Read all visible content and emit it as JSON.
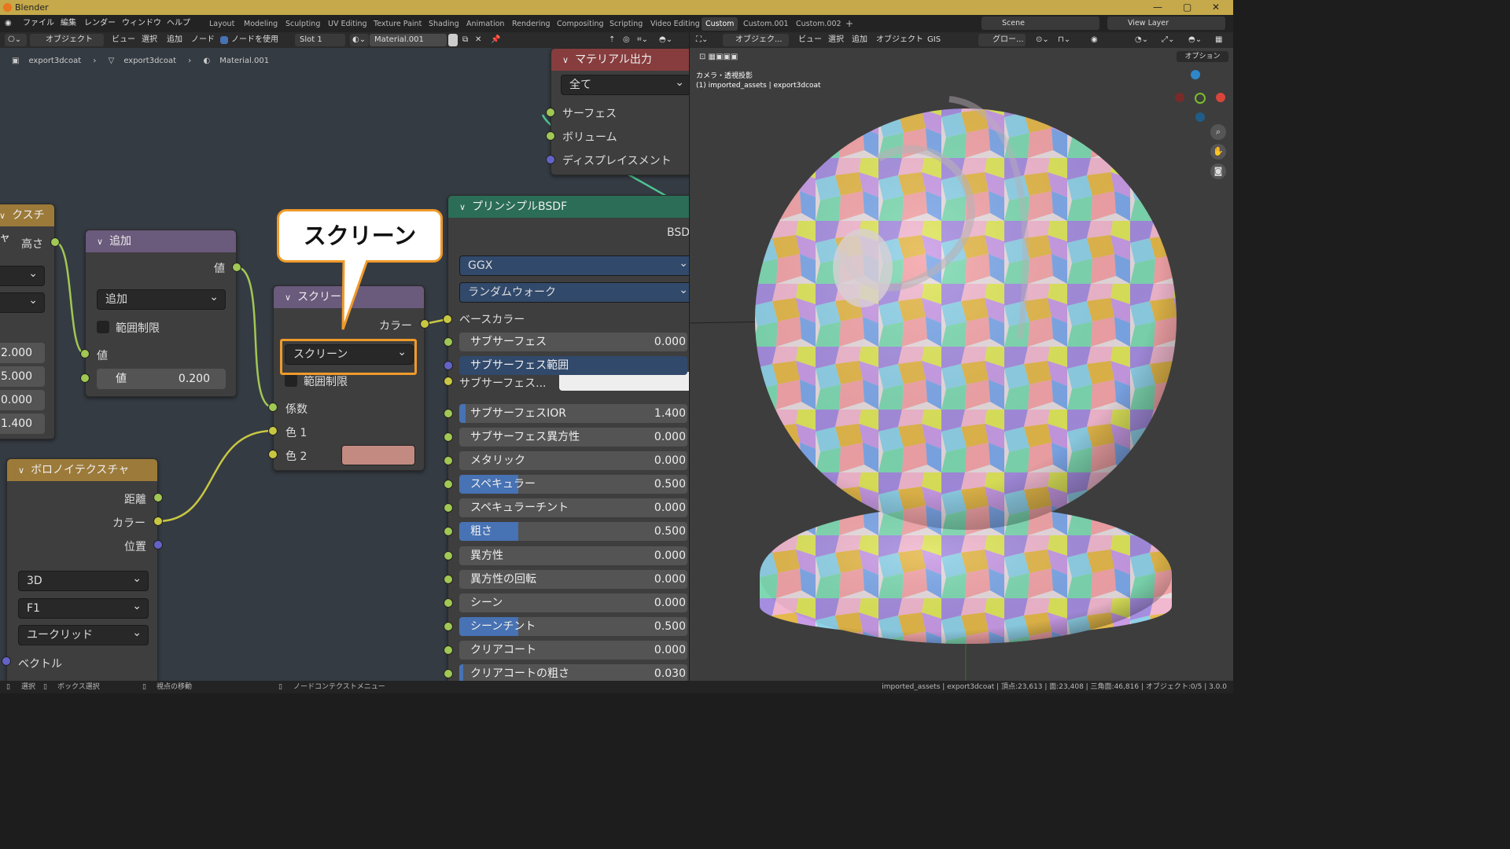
{
  "app": {
    "title": "Blender",
    "menu": [
      "ファイル",
      "編集",
      "レンダー",
      "ウィンドウ",
      "ヘルプ"
    ],
    "workspaces": [
      "Layout",
      "Modeling",
      "Sculpting",
      "UV Editing",
      "Texture Paint",
      "Shading",
      "Animation",
      "Rendering",
      "Compositing",
      "Scripting",
      "Video Editing",
      "Custom",
      "Custom.001",
      "Custom.002"
    ],
    "active_workspace": "Custom",
    "add_workspace": "+",
    "scene": "Scene",
    "view_layer": "View Layer"
  },
  "node_header": {
    "mode": "オブジェクト",
    "view": "ビュー",
    "select": "選択",
    "add": "追加",
    "node": "ノード",
    "use_nodes": "ノードを使用",
    "slot": "Slot 1",
    "material": "Material.001"
  },
  "breadcrumb": [
    "export3dcoat",
    "export3dcoat",
    "Material.001"
  ],
  "callout": {
    "text": "スクリーン"
  },
  "nodes": {
    "tex_left": {
      "title": "クスチャ",
      "out_height": "高さ",
      "values": [
        "2.000",
        "5.000",
        "0.000",
        "1.400"
      ]
    },
    "add": {
      "title": "追加",
      "out_value": "値",
      "operation": "追加",
      "clamp": "範囲制限",
      "in_value1": "値",
      "in_value2_label": "値",
      "in_value2": "0.200"
    },
    "screen": {
      "title": "スクリー",
      "out_color": "カラー",
      "blend": "スクリーン",
      "clamp": "範囲制限",
      "fac": "係数",
      "color1": "色 1",
      "color2": "色 2",
      "color2_swatch": "#c38a81"
    },
    "voronoi": {
      "title": "ボロノイテクスチャ",
      "out_distance": "距離",
      "out_color": "カラー",
      "out_position": "位置",
      "dimensions": "3D",
      "feature": "F1",
      "metric": "ユークリッド",
      "in_vector": "ベクトル"
    },
    "output": {
      "title": "マテリアル出力",
      "target": "全て",
      "surface": "サーフェス",
      "volume": "ボリューム",
      "displacement": "ディスプレイスメント"
    },
    "bsdf": {
      "title": "プリンシプルBSDF",
      "out_bsdf": "BSDF",
      "distribution": "GGX",
      "subsurface_method": "ランダムウォーク",
      "base_color": "ベースカラー",
      "subsurface_color_label": "サブサーフェス...",
      "props": [
        {
          "name": "サブサーフェス",
          "value": "0.000",
          "fill": 0
        },
        {
          "name": "サブサーフェス範囲",
          "value": "",
          "fill": 1
        },
        {
          "name": "サブサーフェスIOR",
          "value": "1.400",
          "fill": 0.05
        },
        {
          "name": "サブサーフェス異方性",
          "value": "0.000",
          "fill": 0
        },
        {
          "name": "メタリック",
          "value": "0.000",
          "fill": 0
        },
        {
          "name": "スペキュラー",
          "value": "0.500",
          "fill": 0.5
        },
        {
          "name": "スペキュラーチント",
          "value": "0.000",
          "fill": 0
        },
        {
          "name": "粗さ",
          "value": "0.500",
          "fill": 0.5
        },
        {
          "name": "異方性",
          "value": "0.000",
          "fill": 0
        },
        {
          "name": "異方性の回転",
          "value": "0.000",
          "fill": 0
        },
        {
          "name": "シーン",
          "value": "0.000",
          "fill": 0
        },
        {
          "name": "シーンチント",
          "value": "0.500",
          "fill": 0.5
        },
        {
          "name": "クリアコート",
          "value": "0.000",
          "fill": 0
        },
        {
          "name": "クリアコートの粗さ",
          "value": "0.030",
          "fill": 0.03
        }
      ]
    }
  },
  "viewport_header": {
    "mode": "オブジェク...",
    "view": "ビュー",
    "select": "選択",
    "add": "追加",
    "object": "オブジェクト",
    "gis": "GIS",
    "transform": "グロー...",
    "options": "オプション"
  },
  "viewport": {
    "camera_label": "カメラ・透視投影",
    "collection_label": "(1) imported_assets | export3dcoat"
  },
  "statusbar": {
    "select": "選択",
    "box_select": "ボックス選択",
    "move_view": "視点の移動",
    "context_menu": "ノードコンテクストメニュー",
    "stats": "imported_assets | export3dcoat | 頂点:23,613 | 面:23,408 | 三角面:46,816 | オブジェクト:0/5 | 3.0.0"
  }
}
